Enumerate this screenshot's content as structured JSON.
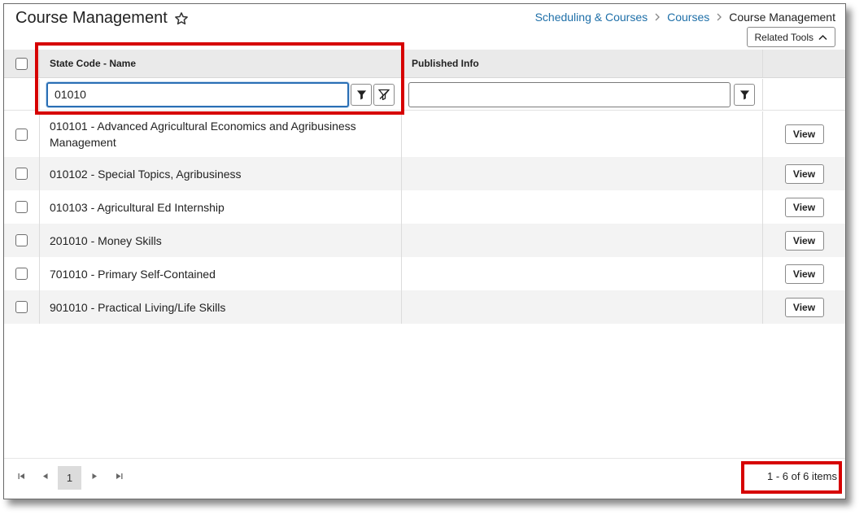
{
  "header": {
    "title": "Course Management",
    "star_icon": "star-icon",
    "breadcrumb": [
      "Scheduling & Courses",
      "Courses",
      "Course Management"
    ],
    "related_tools_label": "Related Tools"
  },
  "grid": {
    "columns": [
      "State Code - Name",
      "Published Info",
      ""
    ],
    "filters": {
      "name_value": "01010",
      "published_value": ""
    },
    "rows": [
      {
        "name": "010101 - Advanced Agricultural Economics and Agribusiness Management",
        "published": "",
        "action": "View"
      },
      {
        "name": "010102 - Special Topics, Agribusiness",
        "published": "",
        "action": "View"
      },
      {
        "name": "010103 - Agricultural Ed Internship",
        "published": "",
        "action": "View"
      },
      {
        "name": "201010 - Money Skills",
        "published": "",
        "action": "View"
      },
      {
        "name": "701010 - Primary Self-Contained",
        "published": "",
        "action": "View"
      },
      {
        "name": "901010 - Practical Living/Life Skills",
        "published": "",
        "action": "View"
      }
    ]
  },
  "pager": {
    "current_page": "1",
    "info": "1 - 6 of 6 items"
  },
  "colors": {
    "link": "#1e6fa8",
    "highlight": "#d60000",
    "header_bg": "#eaeaea",
    "alt_row_bg": "#f3f3f3"
  }
}
